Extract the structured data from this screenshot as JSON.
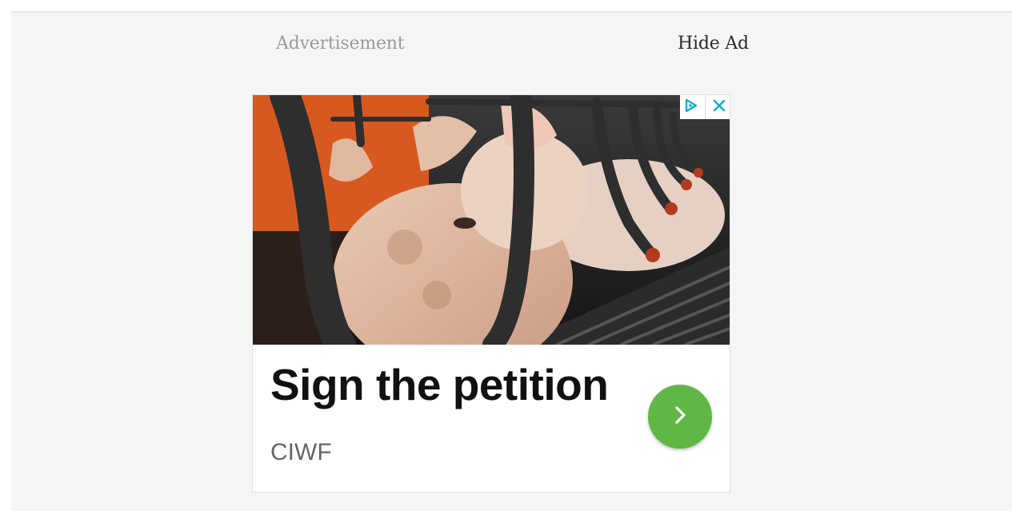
{
  "ad": {
    "label": "Advertisement",
    "hide_label": "Hide Ad",
    "headline": "Sign the petition",
    "advertiser": "CIWF",
    "image": "pig-in-farrowing-crate-photo",
    "icons": {
      "adchoices": "adchoices-icon",
      "close": "close-icon",
      "cta": "chevron-right-icon"
    },
    "colors": {
      "cta_background": "#5fb843",
      "adchoices_icon": "#00aecd",
      "headline": "#111111",
      "advertiser": "#666666",
      "label": "#9a9a9a"
    }
  }
}
